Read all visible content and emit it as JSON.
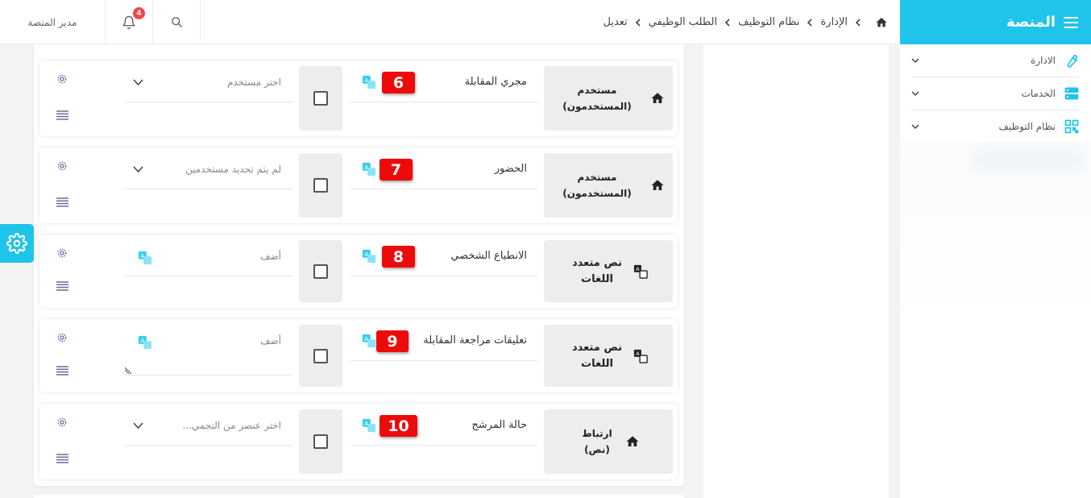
{
  "sidebar": {
    "brand": "المنصة",
    "items": [
      {
        "label": "الادارة",
        "icon": "wrench-icon"
      },
      {
        "label": "الخدمات",
        "icon": "server-icon"
      },
      {
        "label": "نظام التوظيف",
        "icon": "qr-grid-icon"
      }
    ]
  },
  "topbar": {
    "profile_label": "مدير المنصة",
    "notification_count": "4",
    "breadcrumb": [
      "الإدارة",
      "نظام التوظيف",
      "الطلب الوظيفي",
      "تعديل"
    ]
  },
  "colors": {
    "accent": "#1ec4e9",
    "badge_red": "#ee0a0a",
    "notif_red": "#f04646"
  },
  "rows": [
    {
      "number": "6",
      "type_label": "مستخدم (المستخدمون)",
      "type_icon": "home-icon",
      "field_name": "مجري المقابلة",
      "value_text": "اختر مستخدم",
      "value_kind": "select"
    },
    {
      "number": "7",
      "type_label": "مستخدم (المستخدمون)",
      "type_icon": "home-icon",
      "field_name": "الحضور",
      "value_text": "لم يتم تحديد مستخدمين",
      "value_kind": "select"
    },
    {
      "number": "8",
      "type_label": "نص متعدد اللغات",
      "type_icon": "translate-icon",
      "field_name": "الانطباع الشخصي",
      "value_text": "أضف",
      "value_kind": "text"
    },
    {
      "number": "9",
      "type_label": "نص متعدد اللغات",
      "type_icon": "translate-icon",
      "field_name": "تعليقات مراجعة المقابلة",
      "value_text": "أضف",
      "value_kind": "textarea"
    },
    {
      "number": "10",
      "type_label": "ارتباط (نص)",
      "type_icon": "home-icon",
      "field_name": "حالة المرشح",
      "value_text": "اختر عنصر من التجمي...",
      "value_kind": "select"
    }
  ]
}
